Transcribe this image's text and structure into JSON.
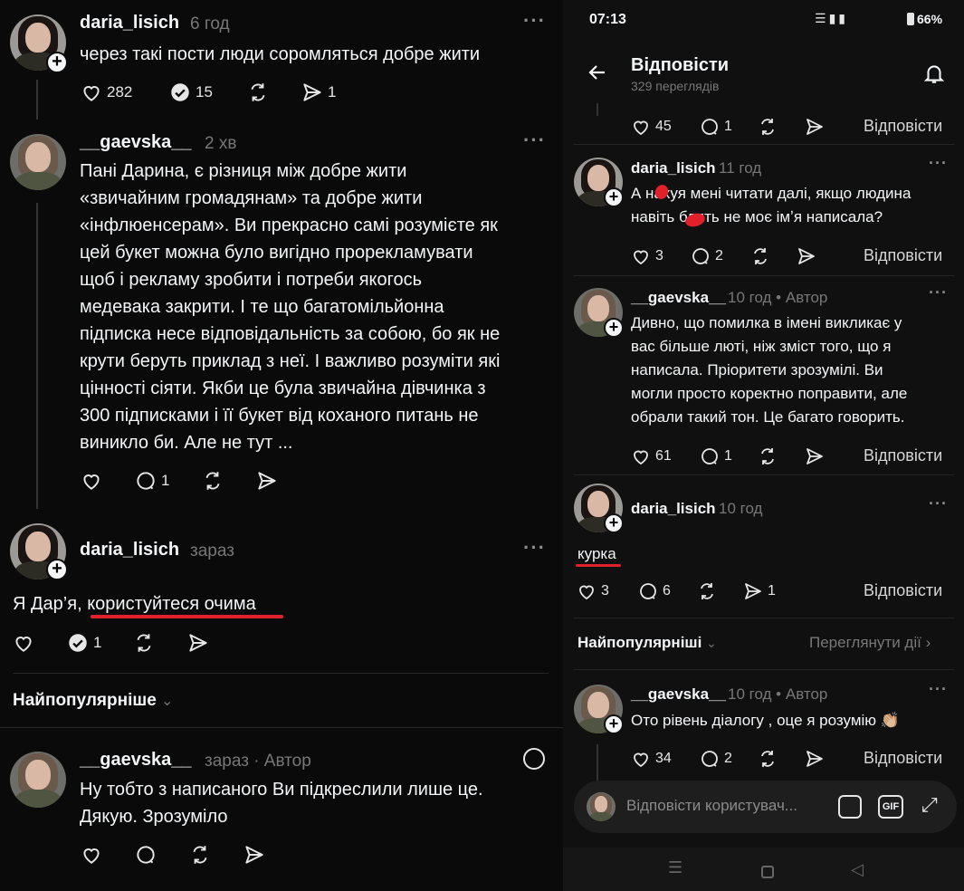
{
  "left": {
    "post1": {
      "username": "daria_lisich",
      "time": "6 год",
      "text": "через такі пости люди соромляться добре жити",
      "likes": "282",
      "reposts": "15",
      "shares": "1"
    },
    "post2": {
      "username": "__gaevska__",
      "time": "2 хв",
      "lines": [
        "Пані Дарина, є різниця між добре жити",
        "«звичайним громадянам» та добре жити",
        "«інфлюенсерам». Ви прекрасно самі розумієте як",
        "цей букет можна було вигідно прорекламувати",
        "щоб і рекламу зробити і потреби якогось",
        "медевака закрити. І те що багатомільйонна",
        "підписка несе відповідальність за собою, бо як не",
        "крути беруть приклад з неї. І важливо розуміти які",
        "цінності сіяти.  Якби це була звичайна дівчинка з",
        "300 підписками і її букет від коханого питань не",
        "виникло би. Але не тут ..."
      ],
      "comments": "1"
    },
    "post3": {
      "username": "daria_lisich",
      "time": "зараз",
      "text_a": "Я Дар’я, ",
      "text_b": "користуйтеся очима",
      "reposts": "1"
    },
    "sort_label": "Найпопулярніше",
    "post4": {
      "username": "__gaevska__",
      "time": "зараз · Автор",
      "lines": [
        "Ну тобто з написаного Ви підкреслили лише це.",
        "Дякую. Зрозуміло"
      ]
    }
  },
  "right": {
    "status": {
      "time": "07:13",
      "battery": "66%"
    },
    "header": {
      "title": "Відповісти",
      "views": "329 переглядів"
    },
    "reply_label": "Відповісти",
    "r0": {
      "likes": "45",
      "comments": "1"
    },
    "r1": {
      "username": "daria_lisich",
      "time": "11 год",
      "line1": "А нахуя мені читати далі, якщо людина",
      "line2": "навіть блять не моє імʼя написала?",
      "likes": "3",
      "comments": "2"
    },
    "r2": {
      "username": "__gaevska__",
      "time": "10 год • Автор",
      "lines": [
        "Дивно, що помилка в імені викликає у",
        "вас більше люті, ніж зміст того, що я",
        "написала. Пріоритети зрозумілі. Ви",
        "могли просто коректно поправити, але",
        "обрали такий тон. Це багато говорить."
      ],
      "likes": "61",
      "comments": "1"
    },
    "r3": {
      "username": "daria_lisich",
      "time": "10 год",
      "text": "курка",
      "likes": "3",
      "comments": "6",
      "shares": "1"
    },
    "sort_label": "Найпопулярніші",
    "view_actions": "Переглянути дії",
    "r4": {
      "username": "__gaevska__",
      "time": "10 год • Автор",
      "text": "Ото рівень діалогу , оце я розумію 👏🏼",
      "likes": "34",
      "comments": "2"
    },
    "composer": {
      "placeholder": "Відповісти користувач...",
      "gif": "GIF"
    }
  }
}
